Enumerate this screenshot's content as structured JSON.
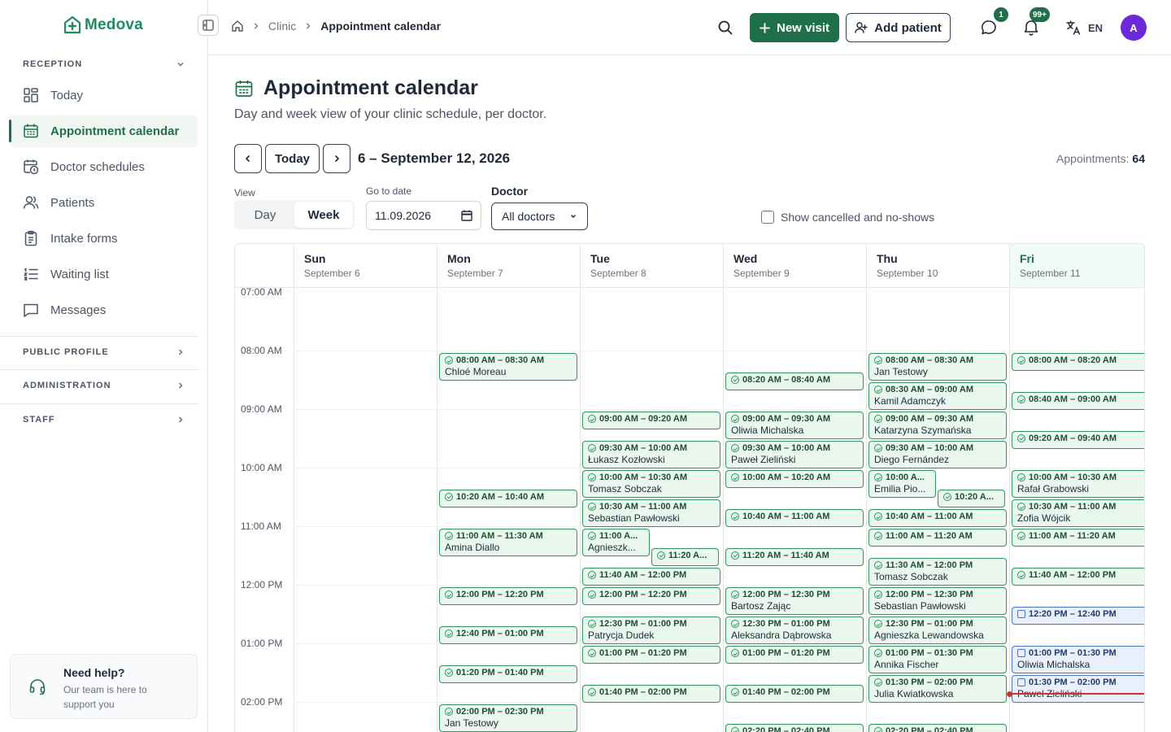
{
  "brand": {
    "name": "Medova",
    "accent": "#1f6f4a"
  },
  "sidebar": {
    "reception_label": "RECEPTION",
    "items": [
      {
        "label": "Today",
        "icon": "dashboard-icon"
      },
      {
        "label": "Appointment calendar",
        "icon": "calendar-icon",
        "active": true
      },
      {
        "label": "Doctor schedules",
        "icon": "calendar-clock-icon"
      },
      {
        "label": "Patients",
        "icon": "users-icon"
      },
      {
        "label": "Intake forms",
        "icon": "clipboard-icon"
      },
      {
        "label": "Waiting list",
        "icon": "list-icon"
      },
      {
        "label": "Messages",
        "icon": "message-icon"
      }
    ],
    "sections": [
      "PUBLIC PROFILE",
      "ADMINISTRATION",
      "STAFF"
    ],
    "help": {
      "title": "Need help?",
      "subtitle": "Our team is here to support you"
    }
  },
  "topbar": {
    "breadcrumb": [
      "Clinic",
      "Appointment calendar"
    ],
    "new_visit": "New visit",
    "add_patient": "Add patient",
    "messages_badge": "1",
    "notifications_badge": "99+",
    "language": "EN",
    "avatar_initial": "A"
  },
  "page": {
    "title": "Appointment calendar",
    "subtitle": "Day and week view of your clinic schedule, per doctor.",
    "today_label": "Today",
    "range": "6 – September 12, 2026",
    "appointments_label": "Appointments:",
    "appointments_count": "64",
    "view_label": "View",
    "view_day": "Day",
    "view_week": "Week",
    "goto_label": "Go to date",
    "goto_value": "11.09.2026",
    "doctor_label": "Doctor",
    "doctor_value": "All doctors",
    "show_cancelled": "Show cancelled and no-shows"
  },
  "calendar": {
    "days": [
      {
        "name": "Sun",
        "date": "September 6"
      },
      {
        "name": "Mon",
        "date": "September 7"
      },
      {
        "name": "Tue",
        "date": "September 8"
      },
      {
        "name": "Wed",
        "date": "September 9"
      },
      {
        "name": "Thu",
        "date": "September 10"
      },
      {
        "name": "Fri",
        "date": "September 11",
        "today": true
      }
    ],
    "times": [
      "07:00 AM",
      "08:00 AM",
      "09:00 AM",
      "10:00 AM",
      "11:00 AM",
      "12:00 PM",
      "01:00 PM",
      "02:00 PM"
    ],
    "events": [
      {
        "day": 1,
        "start": 8.0,
        "end": 8.5,
        "time": "08:00 AM – 08:30 AM",
        "name": "Chloé Moreau"
      },
      {
        "day": 1,
        "start": 10.333,
        "end": 10.667,
        "time": "10:20 AM – 10:40 AM",
        "name": ""
      },
      {
        "day": 1,
        "start": 11.0,
        "end": 11.5,
        "time": "11:00 AM – 11:30 AM",
        "name": "Amina Diallo"
      },
      {
        "day": 1,
        "start": 12.0,
        "end": 12.333,
        "time": "12:00 PM – 12:20 PM",
        "name": ""
      },
      {
        "day": 1,
        "start": 12.667,
        "end": 13.0,
        "time": "12:40 PM – 01:00 PM",
        "name": ""
      },
      {
        "day": 1,
        "start": 13.333,
        "end": 13.667,
        "time": "01:20 PM – 01:40 PM",
        "name": ""
      },
      {
        "day": 1,
        "start": 14.0,
        "end": 14.5,
        "time": "02:00 PM – 02:30 PM",
        "name": "Jan Testowy"
      },
      {
        "day": 2,
        "start": 9.0,
        "end": 9.333,
        "time": "09:00 AM – 09:20 AM",
        "name": ""
      },
      {
        "day": 2,
        "start": 9.5,
        "end": 10.0,
        "time": "09:30 AM – 10:00 AM",
        "name": "Łukasz Kozłowski"
      },
      {
        "day": 2,
        "start": 10.0,
        "end": 10.5,
        "time": "10:00 AM – 10:30 AM",
        "name": "Tomasz Sobczak"
      },
      {
        "day": 2,
        "start": 10.5,
        "end": 11.0,
        "time": "10:30 AM – 11:00 AM",
        "name": "Sebastian Pawłowski"
      },
      {
        "day": 2,
        "start": 11.0,
        "end": 11.5,
        "time": "11:00 A...",
        "name": "Agnieszk...",
        "half": "left"
      },
      {
        "day": 2,
        "start": 11.333,
        "end": 11.667,
        "time": "11:20 A...",
        "name": "",
        "half": "right"
      },
      {
        "day": 2,
        "start": 11.667,
        "end": 12.0,
        "time": "11:40 AM – 12:00 PM",
        "name": ""
      },
      {
        "day": 2,
        "start": 12.0,
        "end": 12.333,
        "time": "12:00 PM – 12:20 PM",
        "name": ""
      },
      {
        "day": 2,
        "start": 12.5,
        "end": 13.0,
        "time": "12:30 PM – 01:00 PM",
        "name": "Patrycja Dudek"
      },
      {
        "day": 2,
        "start": 13.0,
        "end": 13.333,
        "time": "01:00 PM – 01:20 PM",
        "name": ""
      },
      {
        "day": 2,
        "start": 13.667,
        "end": 14.0,
        "time": "01:40 PM – 02:00 PM",
        "name": ""
      },
      {
        "day": 3,
        "start": 8.333,
        "end": 8.667,
        "time": "08:20 AM – 08:40 AM",
        "name": ""
      },
      {
        "day": 3,
        "start": 9.0,
        "end": 9.5,
        "time": "09:00 AM – 09:30 AM",
        "name": "Oliwia Michalska"
      },
      {
        "day": 3,
        "start": 9.5,
        "end": 10.0,
        "time": "09:30 AM – 10:00 AM",
        "name": "Paweł Zieliński"
      },
      {
        "day": 3,
        "start": 10.0,
        "end": 10.333,
        "time": "10:00 AM – 10:20 AM",
        "name": ""
      },
      {
        "day": 3,
        "start": 10.667,
        "end": 11.0,
        "time": "10:40 AM – 11:00 AM",
        "name": ""
      },
      {
        "day": 3,
        "start": 11.333,
        "end": 11.667,
        "time": "11:20 AM – 11:40 AM",
        "name": ""
      },
      {
        "day": 3,
        "start": 12.0,
        "end": 12.5,
        "time": "12:00 PM – 12:30 PM",
        "name": "Bartosz Zając"
      },
      {
        "day": 3,
        "start": 12.5,
        "end": 13.0,
        "time": "12:30 PM – 01:00 PM",
        "name": "Aleksandra Dąbrowska"
      },
      {
        "day": 3,
        "start": 13.0,
        "end": 13.333,
        "time": "01:00 PM – 01:20 PM",
        "name": ""
      },
      {
        "day": 3,
        "start": 13.667,
        "end": 14.0,
        "time": "01:40 PM – 02:00 PM",
        "name": ""
      },
      {
        "day": 3,
        "start": 14.333,
        "end": 14.667,
        "time": "02:20 PM – 02:40 PM",
        "name": ""
      },
      {
        "day": 4,
        "start": 8.0,
        "end": 8.5,
        "time": "08:00 AM – 08:30 AM",
        "name": "Jan Testowy"
      },
      {
        "day": 4,
        "start": 8.5,
        "end": 9.0,
        "time": "08:30 AM – 09:00 AM",
        "name": "Kamil Adamczyk"
      },
      {
        "day": 4,
        "start": 9.0,
        "end": 9.5,
        "time": "09:00 AM – 09:30 AM",
        "name": "Katarzyna Szymańska"
      },
      {
        "day": 4,
        "start": 9.5,
        "end": 10.0,
        "time": "09:30 AM – 10:00 AM",
        "name": "Diego Fernández"
      },
      {
        "day": 4,
        "start": 10.0,
        "end": 10.5,
        "time": "10:00 A...",
        "name": "Emilia Pio...",
        "half": "left"
      },
      {
        "day": 4,
        "start": 10.333,
        "end": 10.667,
        "time": "10:20 A...",
        "name": "",
        "half": "right"
      },
      {
        "day": 4,
        "start": 10.667,
        "end": 11.0,
        "time": "10:40 AM – 11:00 AM",
        "name": ""
      },
      {
        "day": 4,
        "start": 11.0,
        "end": 11.333,
        "time": "11:00 AM – 11:20 AM",
        "name": ""
      },
      {
        "day": 4,
        "start": 11.5,
        "end": 12.0,
        "time": "11:30 AM – 12:00 PM",
        "name": "Tomasz Sobczak"
      },
      {
        "day": 4,
        "start": 12.0,
        "end": 12.5,
        "time": "12:00 PM – 12:30 PM",
        "name": "Sebastian Pawłowski"
      },
      {
        "day": 4,
        "start": 12.5,
        "end": 13.0,
        "time": "12:30 PM – 01:00 PM",
        "name": "Agnieszka Lewandowska"
      },
      {
        "day": 4,
        "start": 13.0,
        "end": 13.5,
        "time": "01:00 PM – 01:30 PM",
        "name": "Annika Fischer"
      },
      {
        "day": 4,
        "start": 13.5,
        "end": 14.0,
        "time": "01:30 PM – 02:00 PM",
        "name": "Julia Kwiatkowska"
      },
      {
        "day": 4,
        "start": 14.333,
        "end": 14.667,
        "time": "02:20 PM – 02:40 PM",
        "name": ""
      },
      {
        "day": 5,
        "start": 8.0,
        "end": 8.333,
        "time": "08:00 AM – 08:20 AM",
        "name": ""
      },
      {
        "day": 5,
        "start": 8.667,
        "end": 9.0,
        "time": "08:40 AM – 09:00 AM",
        "name": ""
      },
      {
        "day": 5,
        "start": 9.333,
        "end": 9.667,
        "time": "09:20 AM – 09:40 AM",
        "name": ""
      },
      {
        "day": 5,
        "start": 10.0,
        "end": 10.5,
        "time": "10:00 AM – 10:30 AM",
        "name": "Rafał Grabowski"
      },
      {
        "day": 5,
        "start": 10.5,
        "end": 11.0,
        "time": "10:30 AM – 11:00 AM",
        "name": "Zofia Wójcik"
      },
      {
        "day": 5,
        "start": 11.0,
        "end": 11.333,
        "time": "11:00 AM – 11:20 AM",
        "name": ""
      },
      {
        "day": 5,
        "start": 11.667,
        "end": 12.0,
        "time": "11:40 AM – 12:00 PM",
        "name": ""
      },
      {
        "day": 5,
        "start": 12.333,
        "end": 12.667,
        "time": "12:20 PM – 12:40 PM",
        "name": "",
        "kind": "blue"
      },
      {
        "day": 5,
        "start": 13.0,
        "end": 13.5,
        "time": "01:00 PM – 01:30 PM",
        "name": "Oliwia Michalska",
        "kind": "blue"
      },
      {
        "day": 5,
        "start": 13.5,
        "end": 14.0,
        "time": "01:30 PM – 02:00 PM",
        "name": "Paweł Zieliński",
        "kind": "blue"
      }
    ],
    "now": 13.82
  }
}
